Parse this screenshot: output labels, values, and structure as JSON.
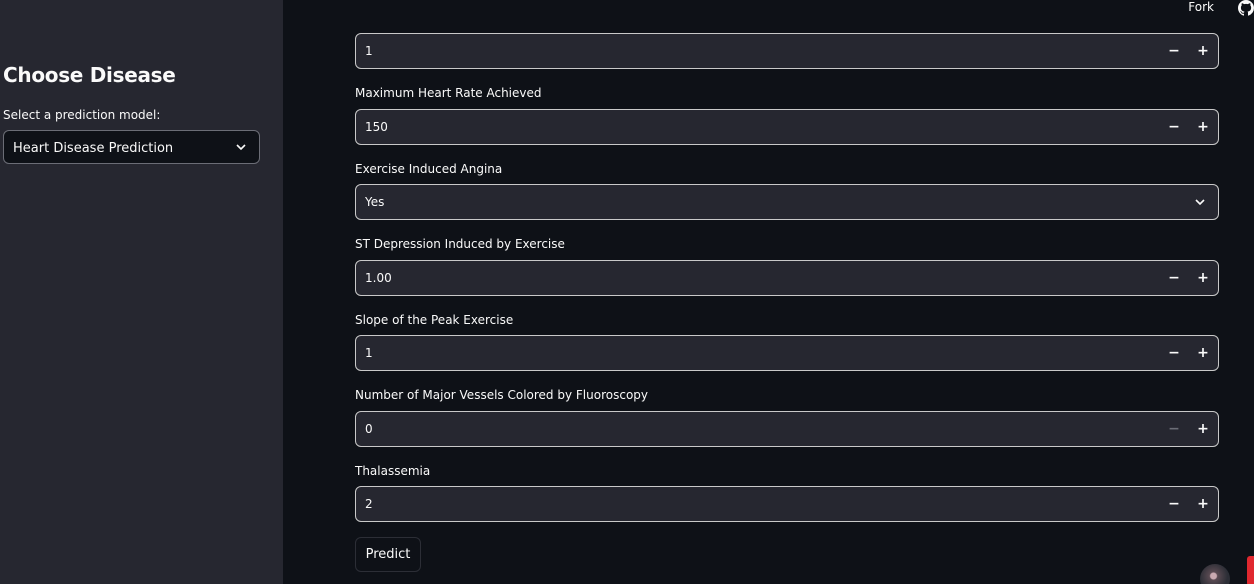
{
  "header": {
    "fork_label": "Fork",
    "github_icon": "github-icon"
  },
  "sidebar": {
    "title": "Choose Disease",
    "select_label": "Select a prediction model:",
    "select_value": "Heart Disease Prediction"
  },
  "form": {
    "top_field": {
      "value": "1"
    },
    "max_heart_rate": {
      "label": "Maximum Heart Rate Achieved",
      "value": "150"
    },
    "exercise_angina": {
      "label": "Exercise Induced Angina",
      "value": "Yes"
    },
    "st_depression": {
      "label": "ST Depression Induced by Exercise",
      "value": "1.00"
    },
    "slope": {
      "label": "Slope of the Peak Exercise",
      "value": "1"
    },
    "major_vessels": {
      "label": "Number of Major Vessels Colored by Fluoroscopy",
      "value": "0"
    },
    "thalassemia": {
      "label": "Thalassemia",
      "value": "2"
    },
    "stepper_minus": "−",
    "stepper_plus": "+",
    "predict_label": "Predict"
  },
  "colors": {
    "background": "#0e1117",
    "sidebar": "#262730",
    "input_bg": "#262730",
    "input_border": "#c9c9c9",
    "text": "#fafafa"
  }
}
